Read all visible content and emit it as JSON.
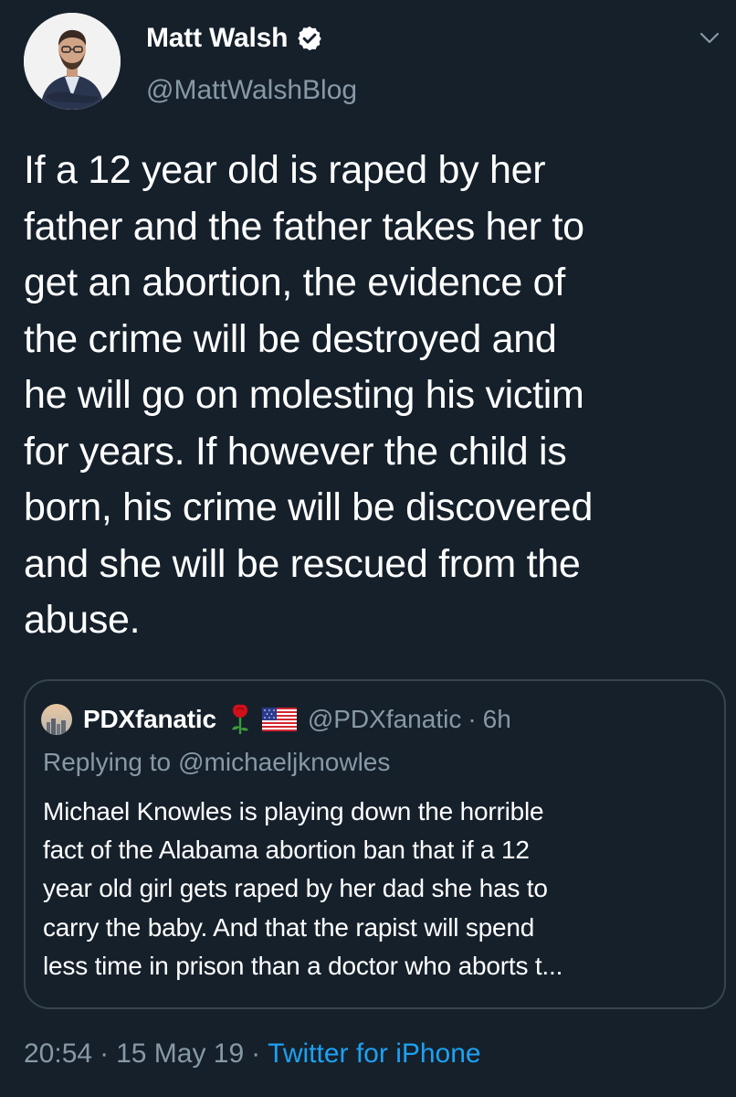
{
  "tweet": {
    "author": {
      "display_name": "Matt Walsh",
      "handle": "@MattWalshBlog",
      "verified": true,
      "avatar_icon": "person-avatar",
      "verified_icon": "verified-badge-icon"
    },
    "text": "If a 12 year old is raped by her\nfather and the father takes her to\nget an abortion, the evidence of\nthe crime will be destroyed and\nhe will go on molesting his victim\nfor years. If however the child is\nborn, his crime will be discovered\nand she will be rescued from the\nabuse.",
    "menu_icon": "chevron-down-icon"
  },
  "quote": {
    "display_name": "PDXfanatic",
    "emoji": [
      "rose-icon",
      "us-flag-icon"
    ],
    "handle": "@PDXfanatic",
    "separator": "·",
    "time": "6h",
    "reply_prefix": "Replying to",
    "reply_to": "@michaeljknowles",
    "text": "Michael Knowles is playing down the horrible\nfact of the Alabama abortion ban that if a 12\nyear old girl gets raped by her dad she has to\ncarry the baby. And that the rapist will spend\nless time in prison than a doctor who aborts t..."
  },
  "meta": {
    "time": "20:54",
    "separator": "·",
    "date": "15 May 19",
    "source": "Twitter for iPhone"
  },
  "colors": {
    "background": "#15202b",
    "text": "#ffffff",
    "secondary": "#8899a6",
    "accent": "#1da1f2",
    "border": "#38444d"
  }
}
